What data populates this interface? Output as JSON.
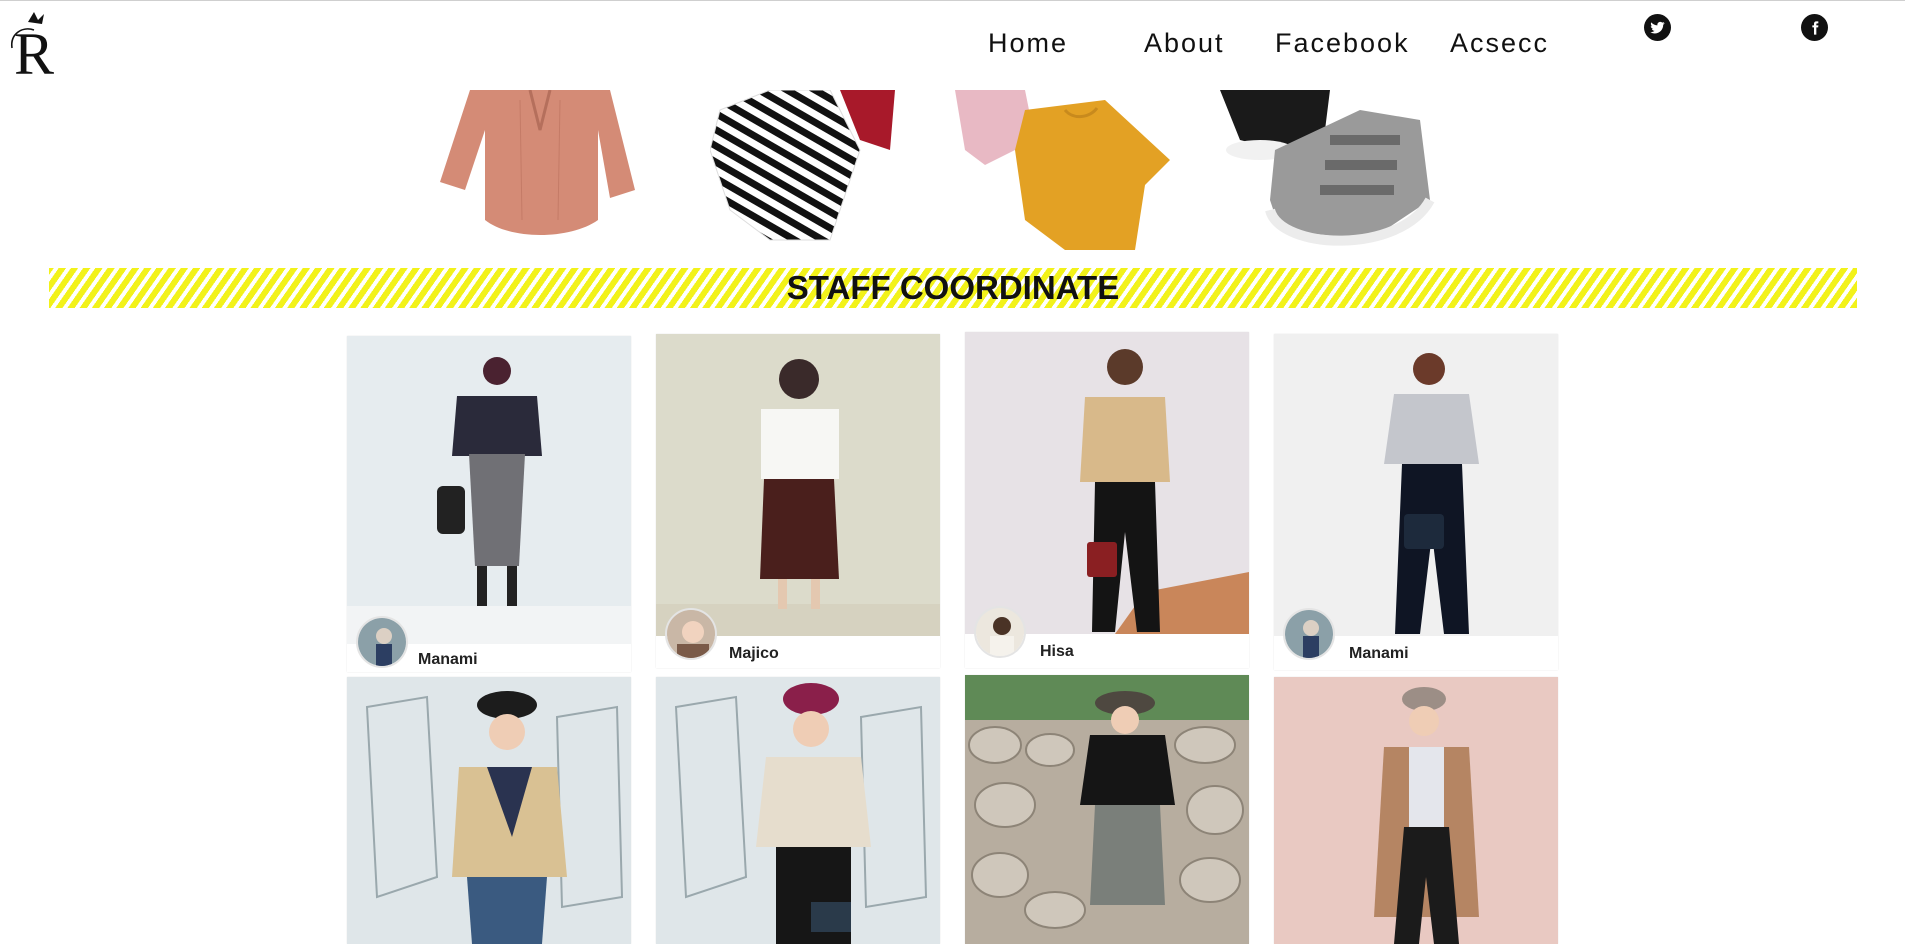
{
  "nav": {
    "items": [
      {
        "label": "Home"
      },
      {
        "label": "About"
      },
      {
        "label": "Facebook"
      },
      {
        "label": "Acsecc"
      }
    ],
    "social": [
      {
        "icon": "twitter-icon"
      },
      {
        "icon": "facebook-icon"
      }
    ]
  },
  "banner": {
    "title": "STAFF COORDINATE",
    "stripe_color": "#f2f21a"
  },
  "cards": [
    {
      "name": "Manami"
    },
    {
      "name": "Majico"
    },
    {
      "name": "Hisa"
    },
    {
      "name": "Manami"
    },
    {
      "name": ""
    },
    {
      "name": ""
    },
    {
      "name": ""
    },
    {
      "name": ""
    }
  ]
}
